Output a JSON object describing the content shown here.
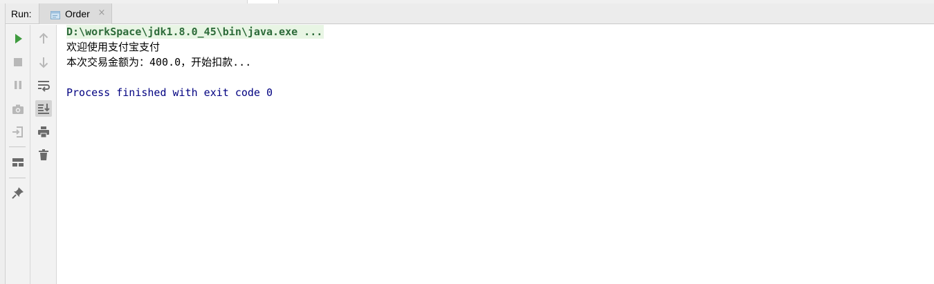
{
  "run_panel": {
    "label": "Run:",
    "tab": {
      "label": "Order",
      "close": "×"
    }
  },
  "toolbar_left": [
    {
      "name": "rerun",
      "icon": "play-icon",
      "color": "#3f9b3f"
    },
    {
      "name": "stop",
      "icon": "stop-icon",
      "color": "#b8b8b8"
    },
    {
      "name": "pause",
      "icon": "pause-icon",
      "color": "#b8b8b8"
    },
    {
      "name": "dump-threads",
      "icon": "camera-icon",
      "color": "#b8b8b8"
    },
    {
      "name": "exit",
      "icon": "exit-icon",
      "color": "#b8b8b8"
    },
    {
      "name": "restore-layout",
      "icon": "layout-icon",
      "color": "#6a6a6a"
    },
    {
      "name": "pin-tab",
      "icon": "pin-icon",
      "color": "#6a6a6a"
    }
  ],
  "toolbar_right": [
    {
      "name": "up-stack-trace",
      "icon": "arrow-up-icon",
      "color": "#b8b8b8"
    },
    {
      "name": "down-stack-trace",
      "icon": "arrow-down-icon",
      "color": "#b8b8b8"
    },
    {
      "name": "soft-wrap",
      "icon": "soft-wrap-icon",
      "color": "#6a6a6a"
    },
    {
      "name": "scroll-to-end",
      "icon": "scroll-to-end-icon",
      "color": "#6a6a6a",
      "active": true
    },
    {
      "name": "print",
      "icon": "print-icon",
      "color": "#6a6a6a"
    },
    {
      "name": "clear-all",
      "icon": "trash-icon",
      "color": "#6a6a6a"
    }
  ],
  "console": {
    "command_line": "D:\\workSpace\\jdk1.8.0_45\\bin\\java.exe ...",
    "output": [
      "欢迎使用支付宝支付",
      "本次交易金额为：400.0，开始扣款..."
    ],
    "exit_message": "Process finished with exit code 0"
  },
  "colors": {
    "command_text": "#2d6b3a",
    "command_bg": "#e8f5e4",
    "exit_text": "#000080",
    "run_green": "#3f9b3f"
  }
}
